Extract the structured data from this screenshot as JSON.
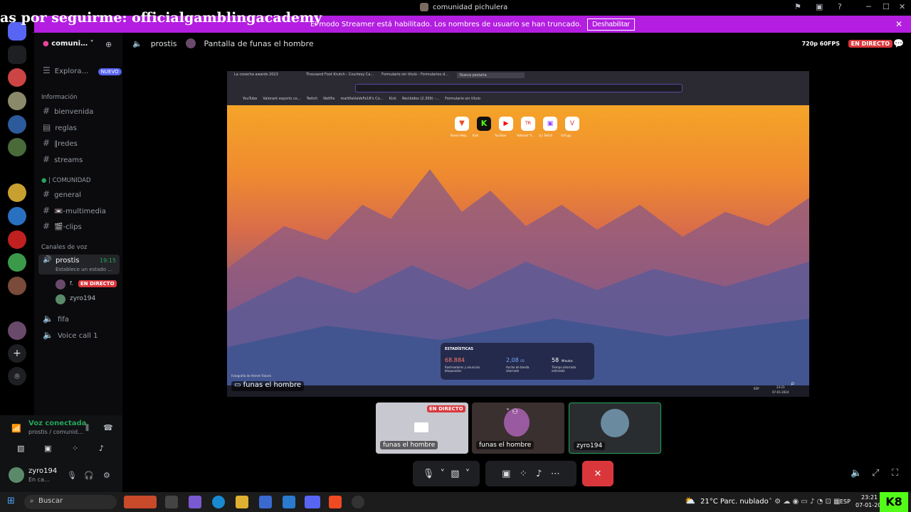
{
  "overlay": {
    "text": "as por seguirme: officialgamblingacademy"
  },
  "window": {
    "title": "comunidad pichulera",
    "minimize": "─",
    "maximize": "☐",
    "close": "✕"
  },
  "streamer_bar": {
    "message": "El modo Streamer está habilitado. Los nombres de usuario se han truncado.",
    "button": "Deshabilitar",
    "close": "✕"
  },
  "server": {
    "name": "comuni…",
    "explore": "Explora…",
    "explore_badge": "NUEVO"
  },
  "categories": {
    "info": "Información",
    "comunidad": "| COMUNIDAD",
    "voice": "Canales de voz"
  },
  "info_channels": [
    {
      "name": "bienvenida"
    },
    {
      "name": "reglas"
    },
    {
      "name": "‖redes"
    },
    {
      "name": "streams"
    }
  ],
  "comunidad_channels": [
    {
      "name": "general"
    },
    {
      "name": "📼-multimedia"
    },
    {
      "name": "🎬-clips"
    }
  ],
  "voice_channels": {
    "active": {
      "name": "prostis",
      "time": "19:15",
      "status": "Establece un estado …"
    },
    "members": [
      {
        "name": "f.",
        "badge": "EN DIRECTO"
      },
      {
        "name": "zyro194"
      }
    ],
    "others": [
      {
        "name": "fifa"
      },
      {
        "name": "Voice call 1"
      }
    ]
  },
  "voice_panel": {
    "status": "Voz conectada",
    "location": "prostis / comunid…"
  },
  "user": {
    "name": "zyro194",
    "status": "En ca…"
  },
  "stage": {
    "channel": "prostis",
    "stream_title": "Pantalla de funas el hombre",
    "quality": "720p 60FPS",
    "live": "EN DIRECTO",
    "stream_owner_label": "funas el hombre"
  },
  "browser": {
    "tabs": [
      "La cosecha awards 2023",
      "Thousand Foot Krutch - Courtesy Ca…",
      "Formulario sin título - Formularios d…",
      "Nueva pestaña"
    ],
    "bookmarks": [
      "YouTube",
      "Valorant esports co…",
      "Twitch",
      "Netflix",
      "matt0eUeVeFe18's Co…",
      "Kick",
      "Recibidos (2.309) -…",
      "Formulario sin título"
    ],
    "shortcuts": [
      "Brave Help…",
      "Kick",
      "YouTube",
      "Valorant Tr…",
      "(1) Twitch",
      "VLR.gg"
    ],
    "stats": {
      "title": "ESTADÍSTICAS",
      "blocked": "68.884",
      "blocked_label": "Rastreadores y anuncios bloqueados",
      "bandwidth": "2,08",
      "bandwidth_unit": "GB",
      "bandwidth_label": "Ancho de banda ahorrado",
      "time": "58",
      "time_unit": "Minutos",
      "time_label": "Tiempo ahorrado estimado"
    },
    "photo_credit": "Fotografía de Ahmet Yüksek",
    "clock": "23:21",
    "date": "07-01-2024",
    "lang": "ESP"
  },
  "thumbs": [
    {
      "label": "funas el hombre",
      "live": "EN DIRECTO"
    },
    {
      "label": "funas el hombre"
    },
    {
      "label": "zyro194"
    }
  ],
  "taskbar": {
    "search": "Buscar",
    "weather": "21°C  Parc. nublado",
    "lang": "ESP",
    "time": "23:21",
    "date": "07-01-2024"
  }
}
